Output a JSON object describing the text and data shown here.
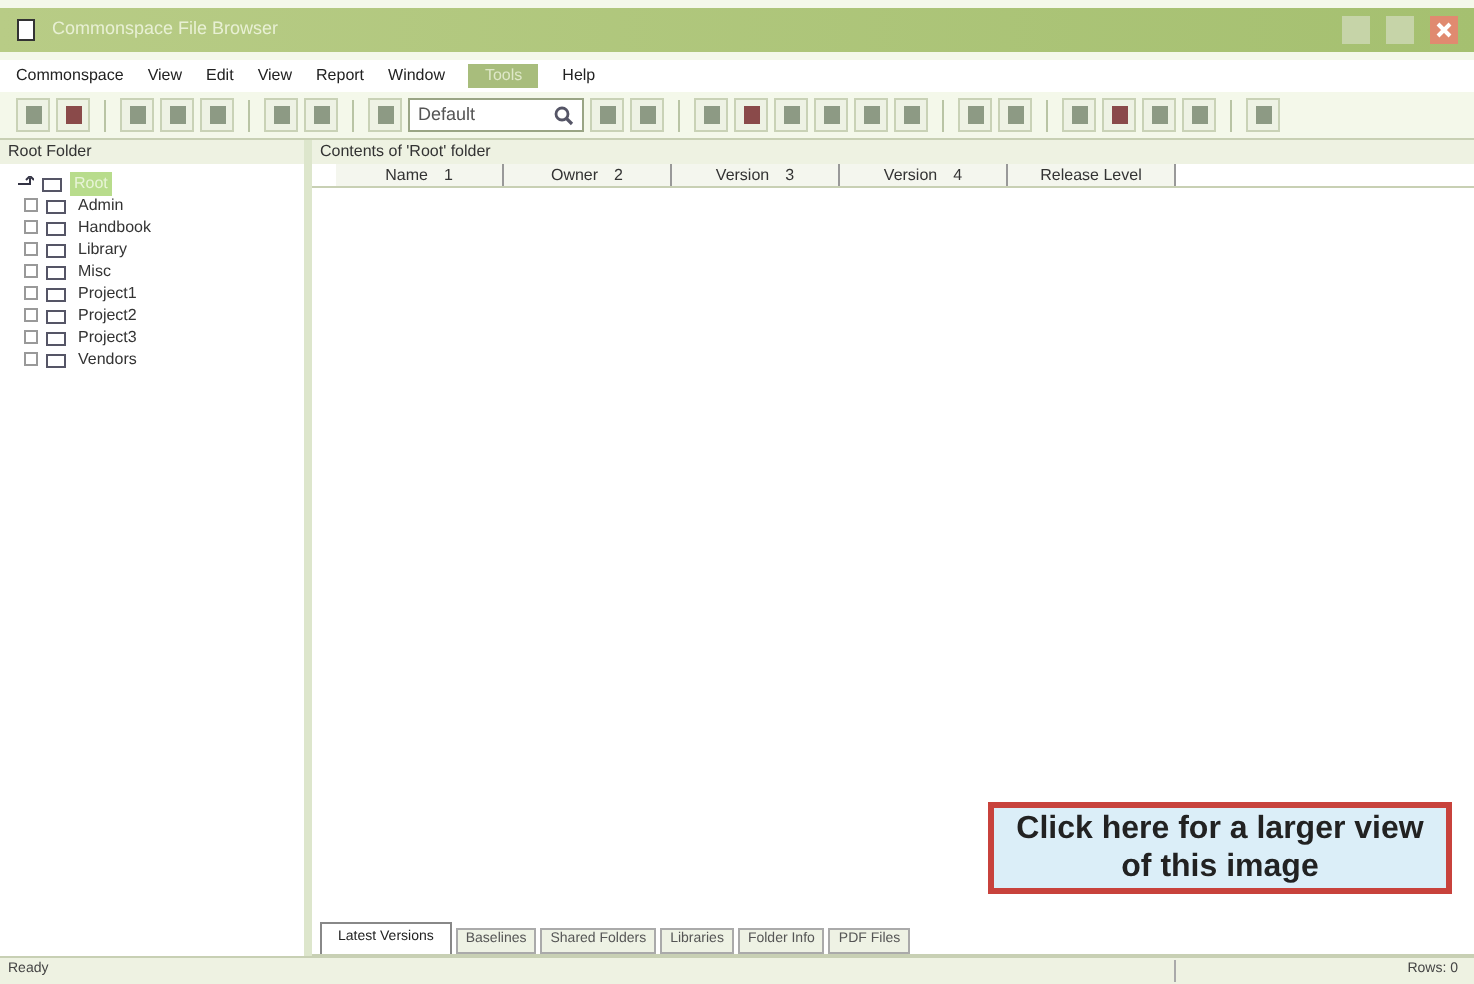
{
  "window": {
    "title": "Commonspace File Browser"
  },
  "menu": [
    {
      "label": "Commonspace",
      "selected": false
    },
    {
      "label": "View",
      "selected": false
    },
    {
      "label": "Edit",
      "selected": false
    },
    {
      "label": "View",
      "selected": false
    },
    {
      "label": "Report",
      "selected": false
    },
    {
      "label": "Window",
      "selected": false
    },
    {
      "label": "Tools",
      "selected": true
    },
    {
      "label": "Help",
      "selected": false
    }
  ],
  "toolbar": [
    {
      "kind": "button"
    },
    {
      "kind": "button"
    },
    {
      "kind": "separator"
    },
    {
      "kind": "button"
    },
    {
      "kind": "button"
    },
    {
      "kind": "button"
    },
    {
      "kind": "separator"
    },
    {
      "kind": "button"
    },
    {
      "kind": "button"
    },
    {
      "kind": "separator"
    },
    {
      "kind": "button"
    },
    {
      "kind": "combo",
      "value": "Default"
    },
    {
      "kind": "button"
    },
    {
      "kind": "button"
    },
    {
      "kind": "separator"
    },
    {
      "kind": "button"
    },
    {
      "kind": "button"
    },
    {
      "kind": "button"
    },
    {
      "kind": "button"
    },
    {
      "kind": "button"
    },
    {
      "kind": "button"
    },
    {
      "kind": "separator"
    },
    {
      "kind": "button"
    },
    {
      "kind": "button"
    },
    {
      "kind": "separator"
    },
    {
      "kind": "button"
    },
    {
      "kind": "button"
    },
    {
      "kind": "button"
    },
    {
      "kind": "button"
    },
    {
      "kind": "separator"
    },
    {
      "kind": "button"
    }
  ],
  "sidebar": {
    "title": "Root Folder",
    "root": {
      "label": "Root",
      "selected": true,
      "children": [
        {
          "label": "Admin"
        },
        {
          "label": "Handbook"
        },
        {
          "label": "Library"
        },
        {
          "label": "Misc"
        },
        {
          "label": "Project1"
        },
        {
          "label": "Project2"
        },
        {
          "label": "Project3"
        },
        {
          "label": "Vendors"
        }
      ]
    }
  },
  "table": {
    "title": "Contents of 'Root' folder",
    "columns": [
      {
        "label": "Name",
        "sort": "1"
      },
      {
        "label": "Owner",
        "sort": "2"
      },
      {
        "label": "Version",
        "sort": "3"
      },
      {
        "label": "Version",
        "sort": "4"
      },
      {
        "label": "Release Level"
      }
    ]
  },
  "tabs": [
    {
      "label": "Latest Versions",
      "selected": true
    },
    {
      "label": "Baselines",
      "selected": false
    },
    {
      "label": "Shared Folders",
      "selected": false
    },
    {
      "label": "Libraries",
      "selected": false
    },
    {
      "label": "Folder Info",
      "selected": false
    },
    {
      "label": "PDF Files",
      "selected": false
    }
  ],
  "overlay_link": "Click here for a larger view of this image",
  "status_bar": {
    "message": "Ready",
    "rows": "Rows: 0"
  }
}
